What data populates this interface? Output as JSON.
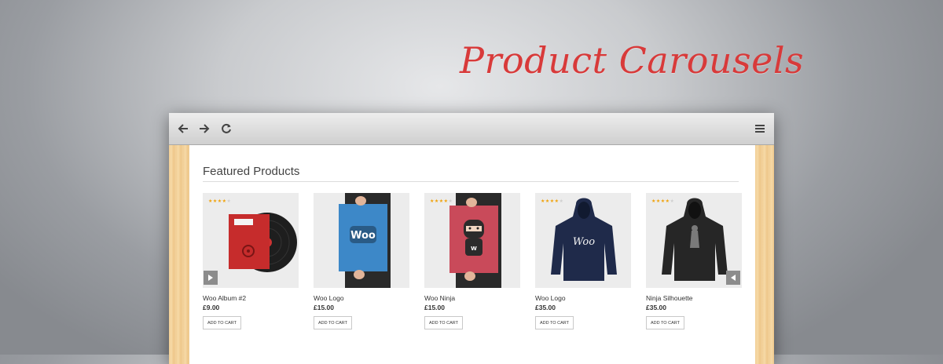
{
  "hero": {
    "title": "Product Carousels"
  },
  "browser": {
    "back_icon": "arrow-left-icon",
    "forward_icon": "arrow-right-icon",
    "reload_icon": "reload-icon",
    "menu_icon": "hamburger-menu-icon"
  },
  "section": {
    "title": "Featured Products"
  },
  "products": [
    {
      "name": "Woo Album #2",
      "price": "£9.00",
      "button": "ADD TO CART",
      "rating": 4,
      "image": "vinyl-album"
    },
    {
      "name": "Woo Logo",
      "price": "£15.00",
      "button": "ADD TO CART",
      "rating": 0,
      "image": "woo-poster"
    },
    {
      "name": "Woo Ninja",
      "price": "£15.00",
      "button": "ADD TO CART",
      "rating": 4,
      "image": "ninja-poster"
    },
    {
      "name": "Woo Logo",
      "price": "£35.00",
      "button": "ADD TO CART",
      "rating": 4,
      "image": "navy-hoodie"
    },
    {
      "name": "Ninja Silhouette",
      "price": "£35.00",
      "button": "ADD TO CART",
      "rating": 4,
      "image": "black-hoodie"
    }
  ],
  "carousel": {
    "next_icon": "play-icon",
    "prev_icon": "back-icon"
  },
  "colors": {
    "headline": "#d83a3a",
    "star": "#f0a20a",
    "woo_blue": "#3d88c8",
    "ninja_red": "#c94a5a"
  }
}
